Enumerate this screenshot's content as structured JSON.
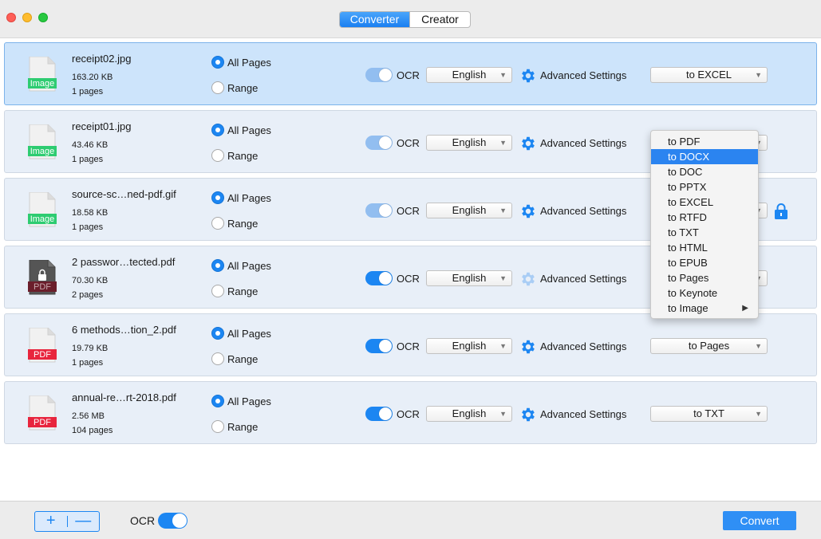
{
  "titlebar": {
    "tabs": [
      {
        "label": "Converter",
        "active": true
      },
      {
        "label": "Creator",
        "active": false
      }
    ]
  },
  "files": [
    {
      "name": "receipt02.jpg",
      "size": "163.20 KB",
      "pages": "1 pages",
      "type": "Image",
      "page_mode": "All Pages",
      "ocr_on": true,
      "language": "English",
      "format": "to EXCEL",
      "selected": true
    },
    {
      "name": "receipt01.jpg",
      "size": "43.46 KB",
      "pages": "1 pages",
      "type": "Image",
      "page_mode": "All Pages",
      "ocr_on": true,
      "language": "English",
      "format": "",
      "selected": false
    },
    {
      "name": "source-sc…ned-pdf.gif",
      "size": "18.58 KB",
      "pages": "1 pages",
      "type": "Image",
      "page_mode": "All Pages",
      "ocr_on": true,
      "language": "English",
      "format": "",
      "selected": false
    },
    {
      "name": "2 passwor…tected.pdf",
      "size": "70.30 KB",
      "pages": "2 pages",
      "type": "PDF",
      "locked": true,
      "page_mode": "All Pages",
      "ocr_on": true,
      "language": "English",
      "format": "",
      "selected": false
    },
    {
      "name": "6 methods…tion_2.pdf",
      "size": "19.79 KB",
      "pages": "1 pages",
      "type": "PDF",
      "page_mode": "All Pages",
      "ocr_on": true,
      "language": "English",
      "format": "to Pages",
      "selected": false
    },
    {
      "name": "annual-re…rt-2018.pdf",
      "size": "2.56 MB",
      "pages": "104 pages",
      "type": "PDF",
      "page_mode": "All Pages",
      "ocr_on": true,
      "language": "English",
      "format": "to TXT",
      "selected": false
    }
  ],
  "labels": {
    "all_pages": "All Pages",
    "range": "Range",
    "ocr": "OCR",
    "advanced": "Advanced Settings"
  },
  "format_menu": {
    "items": [
      "to PDF",
      "to DOCX",
      "to DOC",
      "to PPTX",
      "to EXCEL",
      "to RTFD",
      "to TXT",
      "to HTML",
      "to EPUB",
      "to Pages",
      "to Keynote",
      "to Image"
    ],
    "highlighted": "to DOCX",
    "submenu": "to Image"
  },
  "bottom": {
    "add": "+",
    "remove": "—",
    "ocr": "OCR",
    "convert": "Convert"
  },
  "colors": {
    "accent": "#1c86f2",
    "image_badge": "#2ecc71",
    "pdf_badge": "#e8253d",
    "locked_pdf": "#6b1e2b",
    "selected_row": "#cde4fb",
    "row": "#e8eff8"
  }
}
